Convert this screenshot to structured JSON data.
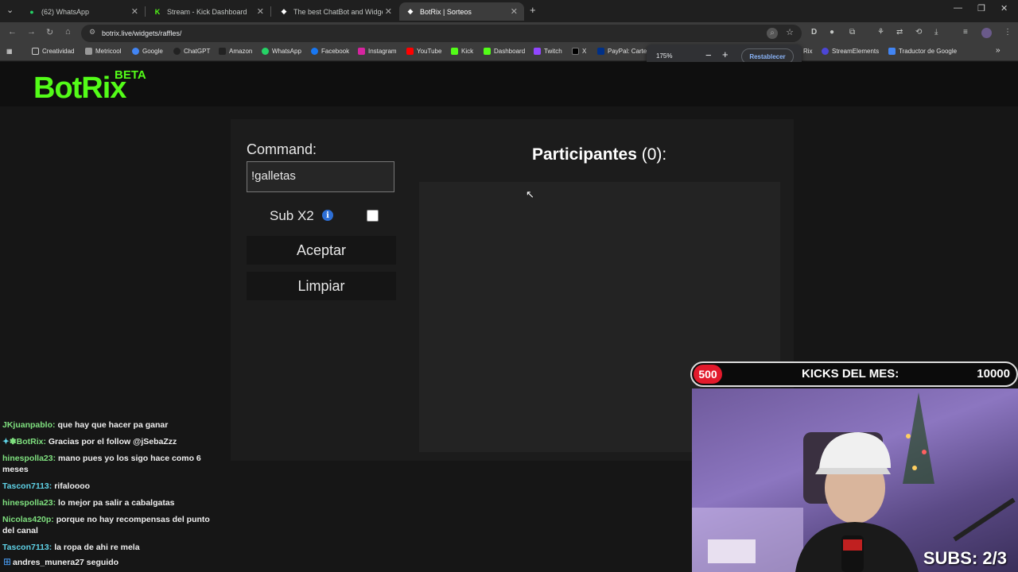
{
  "tabs": [
    {
      "label": "(62) WhatsApp",
      "icon": "whatsapp-icon",
      "color": "#25d366"
    },
    {
      "label": "Stream - Kick Dashboard",
      "icon": "kick-icon",
      "color": "#53fc18"
    },
    {
      "label": "The best ChatBot and Widgets",
      "icon": "botrix-icon",
      "color": "#ffffff"
    },
    {
      "label": "BotRix | Sorteos",
      "icon": "botrix-icon",
      "color": "#ffffff",
      "active": true
    }
  ],
  "address_bar": {
    "url": "botrix.live/widgets/raffles/"
  },
  "bookmarks": [
    "Creatividad",
    "Metricool",
    "Google",
    "ChatGPT",
    "Amazon",
    "WhatsApp",
    "Facebook",
    "Instagram",
    "YouTube",
    "Kick",
    "Dashboard",
    "Twitch",
    "X",
    "PayPal: Carter",
    "Rix",
    "StreamElements",
    "Traductor de Google"
  ],
  "zoom_popup": {
    "level": "175%",
    "reset_label": "Restablecer"
  },
  "site": {
    "logo": "BotRix",
    "beta": "BETA"
  },
  "raffle": {
    "command_label": "Command:",
    "command_value": "!galletas",
    "sub_label": "Sub X2",
    "sub_checked": false,
    "accept_label": "Aceptar",
    "clear_label": "Limpiar",
    "participants_label": "Participantes",
    "participants_count": "(0):"
  },
  "chat": [
    {
      "user": "JKjuanpablo:",
      "text": "que hay que hacer pa ganar",
      "color": "#7fe07f"
    },
    {
      "user": "BotRix:",
      "text": "Gracias por el follow @jSebaZzz",
      "color": "#7fe07f",
      "badge": true
    },
    {
      "user": "hinespolla23:",
      "text": "mano pues yo los sigo hace como 6 meses",
      "color": "#7fe07f"
    },
    {
      "user": "Tascon7113:",
      "text": "rifaloooo",
      "color": "#5fd3e8"
    },
    {
      "user": "hinespolla23:",
      "text": "lo mejor pa salir a cabalgatas",
      "color": "#7fe07f"
    },
    {
      "user": "Nicolas420p:",
      "text": "porque no hay recompensas del punto del canal",
      "color": "#7fe07f"
    },
    {
      "user": "Tascon7113:",
      "text": "la ropa de ahi re mela",
      "color": "#5fd3e8"
    }
  ],
  "follow_alert": "andres_munera27 seguido",
  "overlay": {
    "kicks_current": "500",
    "kicks_label": "KICKS DEL MES:",
    "kicks_goal": "10000",
    "subs": "SUBS: 2/3",
    "accent": "#e21a2c"
  }
}
